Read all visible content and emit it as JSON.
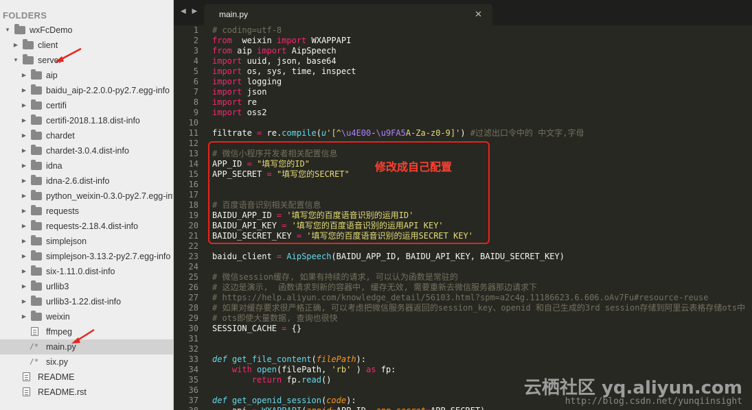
{
  "sidebar": {
    "header": "FOLDERS",
    "items": [
      {
        "label": "wxFcDemo",
        "type": "folder",
        "depth": 0,
        "expanded": true
      },
      {
        "label": "client",
        "type": "folder",
        "depth": 1,
        "expanded": false
      },
      {
        "label": "server",
        "type": "folder",
        "depth": 1,
        "expanded": true
      },
      {
        "label": "aip",
        "type": "folder",
        "depth": 2,
        "expanded": false
      },
      {
        "label": "baidu_aip-2.2.0.0-py2.7.egg-info",
        "type": "folder",
        "depth": 2,
        "expanded": false
      },
      {
        "label": "certifi",
        "type": "folder",
        "depth": 2,
        "expanded": false
      },
      {
        "label": "certifi-2018.1.18.dist-info",
        "type": "folder",
        "depth": 2,
        "expanded": false
      },
      {
        "label": "chardet",
        "type": "folder",
        "depth": 2,
        "expanded": false
      },
      {
        "label": "chardet-3.0.4.dist-info",
        "type": "folder",
        "depth": 2,
        "expanded": false
      },
      {
        "label": "idna",
        "type": "folder",
        "depth": 2,
        "expanded": false
      },
      {
        "label": "idna-2.6.dist-info",
        "type": "folder",
        "depth": 2,
        "expanded": false
      },
      {
        "label": "python_weixin-0.3.0-py2.7.egg-info",
        "type": "folder",
        "depth": 2,
        "expanded": false
      },
      {
        "label": "requests",
        "type": "folder",
        "depth": 2,
        "expanded": false
      },
      {
        "label": "requests-2.18.4.dist-info",
        "type": "folder",
        "depth": 2,
        "expanded": false
      },
      {
        "label": "simplejson",
        "type": "folder",
        "depth": 2,
        "expanded": false
      },
      {
        "label": "simplejson-3.13.2-py2.7.egg-info",
        "type": "folder",
        "depth": 2,
        "expanded": false
      },
      {
        "label": "six-1.11.0.dist-info",
        "type": "folder",
        "depth": 2,
        "expanded": false
      },
      {
        "label": "urllib3",
        "type": "folder",
        "depth": 2,
        "expanded": false
      },
      {
        "label": "urllib3-1.22.dist-info",
        "type": "folder",
        "depth": 2,
        "expanded": false
      },
      {
        "label": "weixin",
        "type": "folder",
        "depth": 2,
        "expanded": false
      },
      {
        "label": "ffmpeg",
        "type": "doc",
        "depth": 2
      },
      {
        "label": "main.py",
        "type": "py",
        "depth": 2,
        "selected": true
      },
      {
        "label": "six.py",
        "type": "py",
        "depth": 2
      },
      {
        "label": "README",
        "type": "doc",
        "depth": 1
      },
      {
        "label": "README.rst",
        "type": "lines",
        "depth": 1
      }
    ]
  },
  "tabbar": {
    "nav": "◀ ▶",
    "tab_title": "main.py",
    "close": "✕"
  },
  "code_lines": [
    {
      "n": "1",
      "t": [
        [
          "cm",
          "# coding=utf-8"
        ]
      ]
    },
    {
      "n": "2",
      "t": [
        [
          "kw",
          "from"
        ],
        [
          "",
          "  weixin "
        ],
        [
          "kw",
          "import"
        ],
        [
          "",
          " WXAPPAPI"
        ]
      ]
    },
    {
      "n": "3",
      "t": [
        [
          "kw",
          "from"
        ],
        [
          "",
          " aip "
        ],
        [
          "kw",
          "import"
        ],
        [
          "",
          " AipSpeech"
        ]
      ]
    },
    {
      "n": "4",
      "t": [
        [
          "kw",
          "import"
        ],
        [
          "",
          " uuid, json, base64"
        ]
      ]
    },
    {
      "n": "5",
      "t": [
        [
          "kw",
          "import"
        ],
        [
          "",
          " os, sys, time, inspect"
        ]
      ]
    },
    {
      "n": "6",
      "t": [
        [
          "kw",
          "import"
        ],
        [
          "",
          " logging"
        ]
      ]
    },
    {
      "n": "7",
      "t": [
        [
          "kw",
          "import"
        ],
        [
          "",
          " json"
        ]
      ]
    },
    {
      "n": "8",
      "t": [
        [
          "kw",
          "import"
        ],
        [
          "",
          " re"
        ]
      ]
    },
    {
      "n": "9",
      "t": [
        [
          "kw",
          "import"
        ],
        [
          "",
          " oss2"
        ]
      ]
    },
    {
      "n": "10",
      "t": []
    },
    {
      "n": "11",
      "t": [
        [
          "",
          "filtrate "
        ],
        [
          "kw",
          "="
        ],
        [
          "",
          " re."
        ],
        [
          "fn",
          "compile"
        ],
        [
          "",
          "("
        ],
        [
          "it",
          "u"
        ],
        [
          "str",
          "'[^"
        ],
        [
          "nb",
          "\\u4E00"
        ],
        [
          "str",
          "-"
        ],
        [
          "nb",
          "\\u9FA5"
        ],
        [
          "str",
          "A-Za-z0-9]'"
        ],
        [
          "",
          ") "
        ],
        [
          "cm",
          "#过滤出口令中的 中文字,字母"
        ]
      ]
    },
    {
      "n": "12",
      "t": []
    },
    {
      "n": "13",
      "t": [
        [
          "cm",
          "# 微信小程序开发者相关配置信息"
        ]
      ]
    },
    {
      "n": "14",
      "t": [
        [
          "",
          "APP_ID "
        ],
        [
          "kw",
          "="
        ],
        [
          "",
          " "
        ],
        [
          "str",
          "\"填写您的ID\""
        ]
      ]
    },
    {
      "n": "15",
      "t": [
        [
          "",
          "APP_SECRET "
        ],
        [
          "kw",
          "="
        ],
        [
          "",
          " "
        ],
        [
          "str",
          "\"填写您的SECRET\""
        ]
      ]
    },
    {
      "n": "16",
      "t": []
    },
    {
      "n": "17",
      "t": []
    },
    {
      "n": "18",
      "t": [
        [
          "cm",
          "# 百度语音识别相关配置信息"
        ]
      ]
    },
    {
      "n": "19",
      "t": [
        [
          "",
          "BAIDU_APP_ID "
        ],
        [
          "kw",
          "="
        ],
        [
          "",
          " "
        ],
        [
          "str",
          "'填写您的百度语音识别的运用ID'"
        ]
      ]
    },
    {
      "n": "20",
      "t": [
        [
          "",
          "BAIDU_API_KEY "
        ],
        [
          "kw",
          "="
        ],
        [
          "",
          " "
        ],
        [
          "str",
          "'填写您的百度语音识别的运用API KEY'"
        ]
      ]
    },
    {
      "n": "21",
      "t": [
        [
          "",
          "BAIDU_SECRET_KEY "
        ],
        [
          "kw",
          "="
        ],
        [
          "",
          " "
        ],
        [
          "str",
          "'填写您的百度语音识别的运用SECRET KEY'"
        ]
      ]
    },
    {
      "n": "22",
      "t": []
    },
    {
      "n": "23",
      "t": [
        [
          "",
          "baidu_client "
        ],
        [
          "kw",
          "="
        ],
        [
          "",
          " "
        ],
        [
          "fn",
          "AipSpeech"
        ],
        [
          "",
          "(BAIDU_APP_ID, BAIDU_API_KEY, BAIDU_SECRET_KEY)"
        ]
      ]
    },
    {
      "n": "24",
      "t": []
    },
    {
      "n": "25",
      "t": [
        [
          "cm",
          "# 微信session缓存, 如果有持续的请求, 可以认为函数是常驻的"
        ]
      ]
    },
    {
      "n": "26",
      "t": [
        [
          "cm",
          "# 这边是演示,  函数请求到新的容器中, 缓存无效, 需要重新去微信服务器那边请求下"
        ]
      ]
    },
    {
      "n": "27",
      "t": [
        [
          "cm",
          "# https://help.aliyun.com/knowledge_detail/56103.html?spm=a2c4g.11186623.6.606.oAv7Fu#resource-reuse"
        ]
      ]
    },
    {
      "n": "28",
      "t": [
        [
          "cm",
          "# 如果对缓存要求很严格正确, 可以考虑把微信服务器返回的session_key、openid 和自己生成的3rd session存储到阿里云表格存储ots中"
        ]
      ]
    },
    {
      "n": "29",
      "t": [
        [
          "cm",
          "# ots即使大量数据, 查询也很快"
        ]
      ]
    },
    {
      "n": "30",
      "t": [
        [
          "",
          "SESSION_CACHE "
        ],
        [
          "kw",
          "="
        ],
        [
          "",
          " {}"
        ]
      ]
    },
    {
      "n": "31",
      "t": []
    },
    {
      "n": "32",
      "t": []
    },
    {
      "n": "33",
      "t": [
        [
          "it",
          "def"
        ],
        [
          "",
          " "
        ],
        [
          "fn",
          "get_file_content"
        ],
        [
          "",
          "("
        ],
        [
          "pm",
          "filePath"
        ],
        [
          "",
          "):"
        ]
      ]
    },
    {
      "n": "34",
      "t": [
        [
          "",
          "    "
        ],
        [
          "kw",
          "with"
        ],
        [
          "",
          " "
        ],
        [
          "fn",
          "open"
        ],
        [
          "",
          "(filePath, "
        ],
        [
          "str",
          "'rb'"
        ],
        [
          "",
          " ) "
        ],
        [
          "kw",
          "as"
        ],
        [
          "",
          " fp:"
        ]
      ]
    },
    {
      "n": "35",
      "t": [
        [
          "",
          "        "
        ],
        [
          "kw",
          "return"
        ],
        [
          "",
          " fp."
        ],
        [
          "fn",
          "read"
        ],
        [
          "",
          "()"
        ]
      ]
    },
    {
      "n": "36",
      "t": []
    },
    {
      "n": "37",
      "t": [
        [
          "it",
          "def"
        ],
        [
          "",
          " "
        ],
        [
          "fn",
          "get_openid_session"
        ],
        [
          "",
          "("
        ],
        [
          "pm",
          "code"
        ],
        [
          "",
          "):"
        ]
      ]
    },
    {
      "n": "38",
      "t": [
        [
          "",
          "    api "
        ],
        [
          "kw",
          "="
        ],
        [
          "",
          " "
        ],
        [
          "fn",
          "WXAPPAPI"
        ],
        [
          "",
          "("
        ],
        [
          "pm",
          "appid"
        ],
        [
          "kw",
          "="
        ],
        [
          "",
          "APP_ID, "
        ],
        [
          "pm",
          "app_secret"
        ],
        [
          "kw",
          "="
        ],
        [
          "",
          "APP_SECRET)"
        ]
      ]
    }
  ],
  "annotation": "修改成自己配置",
  "watermark": "云栖社区 yq.aliyun.com",
  "watermark_url": "http://blog.csdn.net/yunqiinsight",
  "colors": {
    "highlight": "#e8231d",
    "keyword": "#f92672",
    "string": "#e6db74",
    "comment": "#75715e",
    "function": "#66d9ef"
  }
}
